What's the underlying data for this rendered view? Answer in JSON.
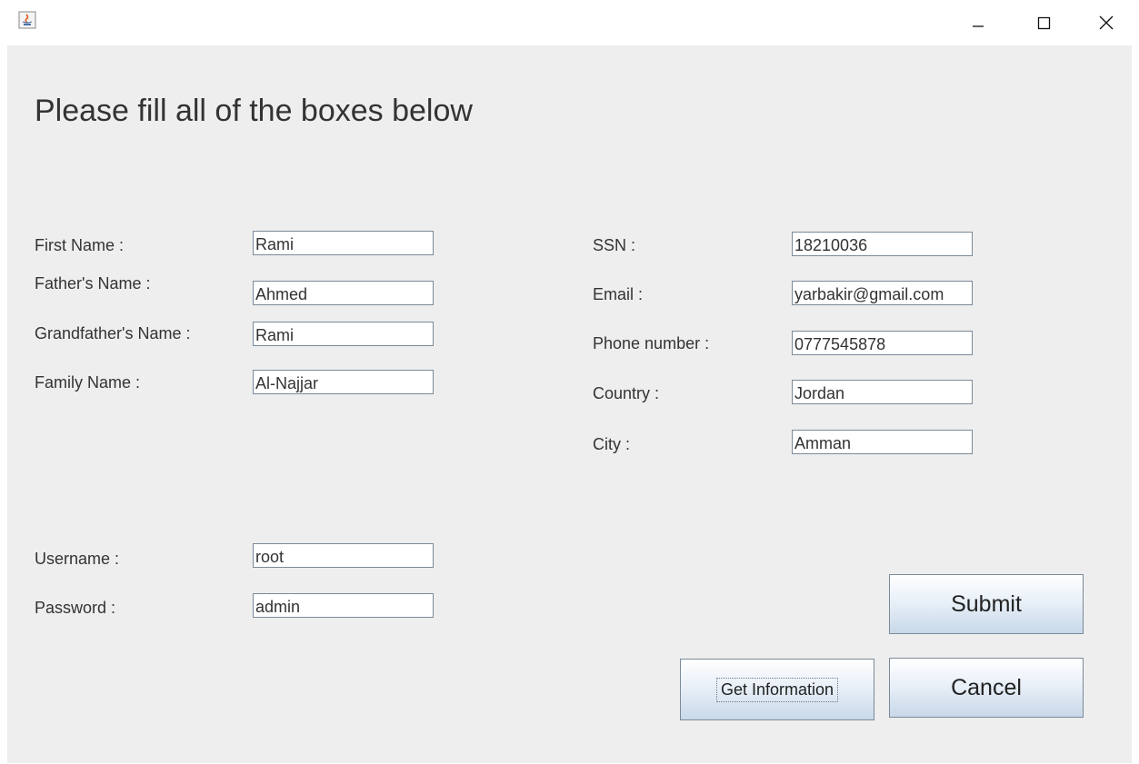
{
  "window": {
    "controls": {
      "minimize": "minimize-icon",
      "maximize": "maximize-icon",
      "close": "close-icon"
    }
  },
  "form": {
    "heading": "Please fill all of the boxes below",
    "left_fields": [
      {
        "label": "First Name :",
        "value": "Rami"
      },
      {
        "label": "Father's Name :",
        "value": "Ahmed"
      },
      {
        "label": "Grandfather's Name :",
        "value": "Rami"
      },
      {
        "label": "Family Name :",
        "value": "Al-Najjar"
      }
    ],
    "right_fields": [
      {
        "label": "SSN :",
        "value": "18210036"
      },
      {
        "label": "Email :",
        "value": "yarbakir@gmail.com"
      },
      {
        "label": "Phone number  :",
        "value": "0777545878"
      },
      {
        "label": "Country :",
        "value": "Jordan"
      },
      {
        "label": "City :",
        "value": "Amman"
      }
    ],
    "account_fields": [
      {
        "label": "Username :",
        "value": "root"
      },
      {
        "label": "Password :",
        "value": "admin"
      }
    ]
  },
  "buttons": {
    "submit": "Submit",
    "cancel": "Cancel",
    "get_information": "Get Information"
  }
}
